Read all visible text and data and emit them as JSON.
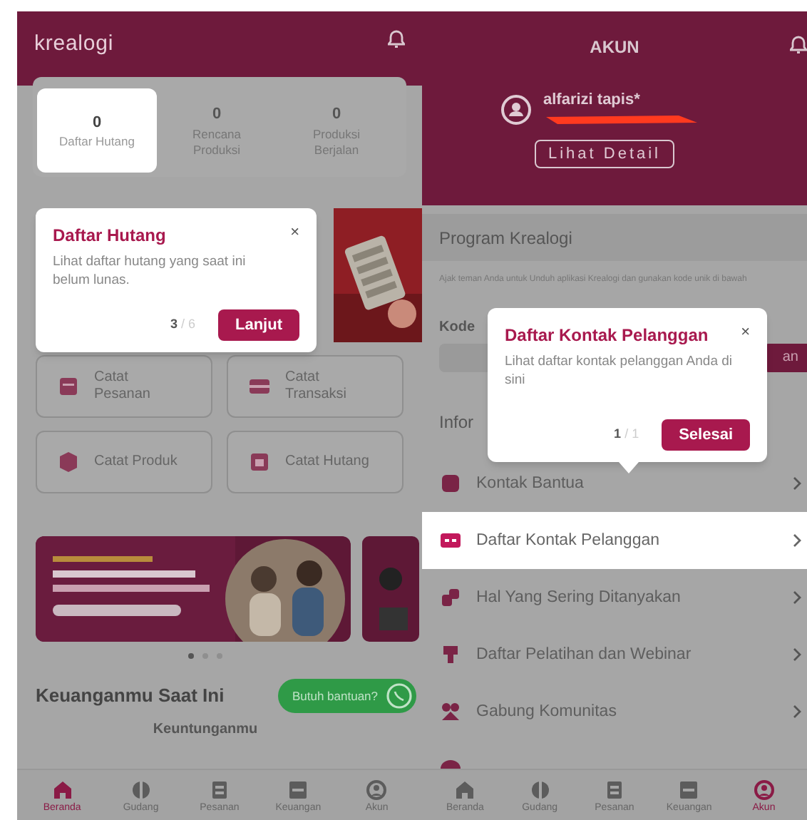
{
  "left_screen": {
    "logo": "krealogi",
    "stats": [
      {
        "value": "0",
        "label": "Daftar Hutang",
        "selected": true
      },
      {
        "value": "0",
        "label": "Rencana Produksi",
        "selected": false
      },
      {
        "value": "0",
        "label": "Produksi Berjalan",
        "selected": false
      }
    ],
    "tooltip": {
      "title": "Daftar Hutang",
      "close": "×",
      "body": "Lihat daftar hutang yang saat ini belum lunas.",
      "step": "3",
      "total": "/ 6",
      "button": "Lanjut"
    },
    "shortcuts": [
      {
        "label": "Catat Pesanan"
      },
      {
        "label": "Catat Transaksi"
      },
      {
        "label": "Catat Produk"
      },
      {
        "label": "Catat Hutang"
      }
    ],
    "carousel_dots": [
      {
        "selected": true
      },
      {
        "selected": false
      },
      {
        "selected": false
      }
    ],
    "section_title": "Keuanganmu Saat Ini",
    "help_button": "Butuh bantuan?",
    "card_title": "Keuntunganmu",
    "nav": [
      {
        "label": "Beranda",
        "selected": true
      },
      {
        "label": "Gudang",
        "selected": false
      },
      {
        "label": "Pesanan",
        "selected": false
      },
      {
        "label": "Keuangan",
        "selected": false
      },
      {
        "label": "Akun",
        "selected": false
      }
    ]
  },
  "right_screen": {
    "title": "AKUN",
    "profile": {
      "name": "alfarizi tapis*",
      "button": "Lihat Detail"
    },
    "program": {
      "title": "Program Krealogi",
      "description": "Ajak teman Anda untuk Unduh aplikasi Krealogi dan gunakan kode unik di bawah",
      "code_label": "Kode",
      "code_button": "an"
    },
    "info_title": "Infor",
    "tooltip": {
      "title": "Daftar Kontak Pelanggan",
      "close": "×",
      "body": "Lihat daftar kontak pelanggan Anda di sini",
      "step": "1",
      "total": "/ 1",
      "button": "Selesai"
    },
    "menu": [
      {
        "label": "Kontak Bantua",
        "selected": false
      },
      {
        "label": "Daftar Kontak Pelanggan",
        "selected": true
      },
      {
        "label": "Hal Yang Sering Ditanyakan",
        "selected": false
      },
      {
        "label": "Daftar Pelatihan dan Webinar",
        "selected": false
      },
      {
        "label": "Gabung Komunitas",
        "selected": false
      }
    ],
    "nav": [
      {
        "label": "Beranda",
        "selected": false
      },
      {
        "label": "Gudang",
        "selected": false
      },
      {
        "label": "Pesanan",
        "selected": false
      },
      {
        "label": "Keuangan",
        "selected": false
      },
      {
        "label": "Akun",
        "selected": true
      }
    ]
  }
}
